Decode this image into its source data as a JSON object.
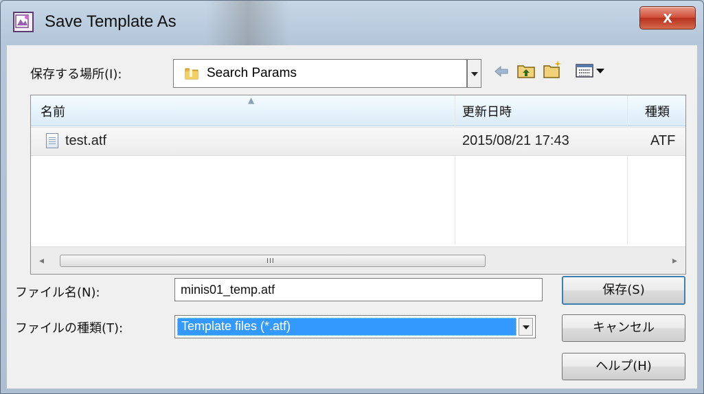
{
  "window": {
    "title": "Save Template As",
    "close_glyph": "x"
  },
  "save_in": {
    "label": "保存する場所(I):",
    "folder_name": "Search Params",
    "folder_icon": "folder-icon"
  },
  "toolbar": {
    "back_icon": "back-arrow-icon",
    "up_icon": "up-folder-icon",
    "new_folder_icon": "new-folder-icon",
    "view_menu_icon": "view-menu-icon"
  },
  "file_list": {
    "columns": [
      "名前",
      "更新日時",
      "種類"
    ],
    "rows": [
      {
        "name": "test.atf",
        "modified": "2015/08/21 17:43",
        "type": "ATF"
      }
    ],
    "scrollbar_grip": "III"
  },
  "filename": {
    "label": "ファイル名(N):",
    "value": "minis01_temp.atf"
  },
  "filetype": {
    "label": "ファイルの種類(T):",
    "selected": "Template files (*.atf)"
  },
  "buttons": {
    "save": "保存(S)",
    "cancel": "キャンセル",
    "help": "ヘルプ(H)"
  },
  "colors": {
    "selection": "#3399ff",
    "close_button": "#c94a36",
    "default_button_border": "#3c7fb1"
  }
}
